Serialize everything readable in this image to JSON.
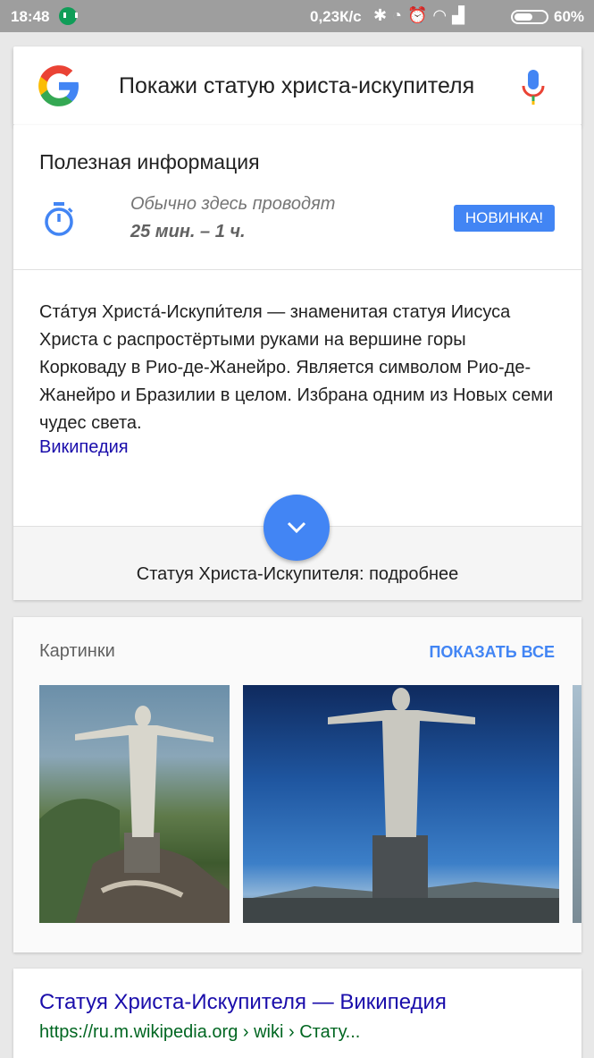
{
  "status_bar": {
    "time": "18:48",
    "speed": "0,23К/с",
    "battery_percent": "60%",
    "battery_level": 0.6,
    "icons": [
      "hangouts-icon",
      "bluetooth-icon",
      "mute-icon",
      "alarm-icon",
      "wifi-icon",
      "signal-icon",
      "battery-icon"
    ]
  },
  "search": {
    "query": "Покажи статую христа-искупителя"
  },
  "info_card": {
    "title": "Полезная информация",
    "visit_label": "Обычно здесь проводят",
    "visit_value": "25 мин. – 1 ч.",
    "badge": "НОВИНКА!",
    "description": "Ста́туя Христа́-Искупи́теля — знаменитая статуя Иисуса Христа с распростёртыми руками на вершине горы Корковаду в Рио-де-Жанейро. Является символом Рио-де-Жанейро и Бразилии в целом. Избрана одним из Новых семи чудес света.",
    "source_link": "Википедия",
    "more_text": "Статуя Христа-Искупителя: подробнее"
  },
  "images_card": {
    "title": "Картинки",
    "show_all": "ПОКАЗАТЬ ВСЕ"
  },
  "result": {
    "title": "Статуя Христа-Искупителя — Википедия",
    "url": "https://ru.m.wikipedia.org › wiki › Стату..."
  },
  "colors": {
    "accent": "#4285f4",
    "link": "#1a0dab",
    "url_green": "#006621"
  }
}
